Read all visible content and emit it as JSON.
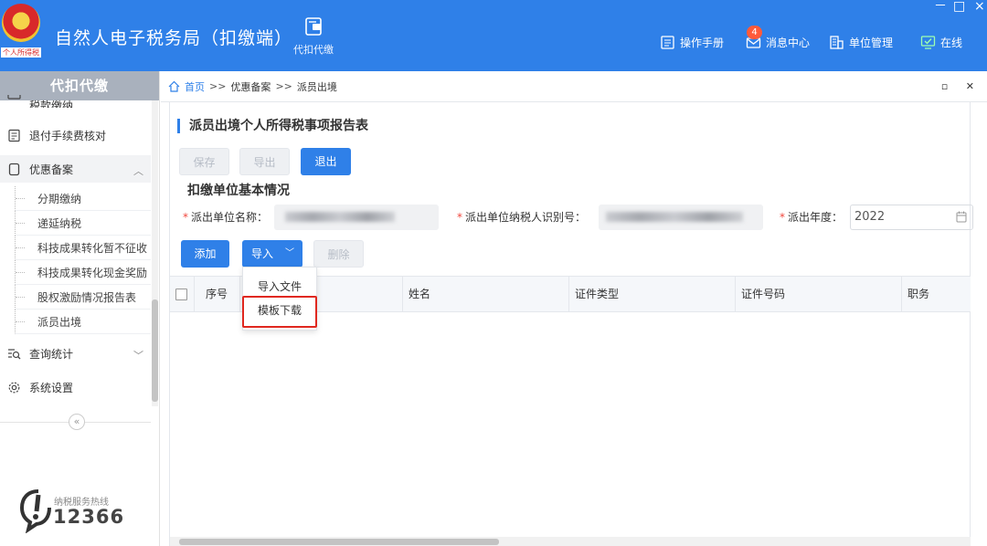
{
  "header": {
    "emblem_text": "个人所得税",
    "app_title": "自然人电子税务局（扣缴端）",
    "nav_label": "代扣代缴",
    "tools": [
      {
        "icon": "manual-icon",
        "label": "操作手册"
      },
      {
        "icon": "message-icon",
        "label": "消息中心",
        "badge": "4"
      },
      {
        "icon": "unit-icon",
        "label": "单位管理"
      },
      {
        "icon": "monitor-online-icon",
        "label": "在线"
      }
    ],
    "window_controls": [
      "－",
      "□",
      "×"
    ]
  },
  "sidebar": {
    "title": "代扣代缴",
    "partial_item": "税款缴纳",
    "items": [
      {
        "icon": "doc-icon",
        "label": "退付手续费核对"
      },
      {
        "icon": "file-icon",
        "label": "优惠备案",
        "expanded": true
      },
      {
        "icon": "search-stats-icon",
        "label": "查询统计"
      },
      {
        "icon": "gear-icon",
        "label": "系统设置"
      }
    ],
    "subitems": [
      "分期缴纳",
      "递延纳税",
      "科技成果转化暂不征收",
      "科技成果转化现金奖励",
      "股权激励情况报告表",
      "派员出境"
    ],
    "collapse_symbol": "«",
    "hotline_label": "纳税服务热线",
    "hotline_number": "12366"
  },
  "breadcrumb": {
    "home": "首页",
    "sep": ">>",
    "level1": "优惠备案",
    "level2": "派员出境",
    "controls": "▫ ✕"
  },
  "form": {
    "title": "派员出境个人所得税事项报告表",
    "buttons": {
      "save": "保存",
      "export": "导出",
      "exit": "退出"
    },
    "section_title": "扣缴单位基本情况",
    "fields": {
      "unit_name_label": "派出单位名称：",
      "tax_id_label": "派出单位纳税人识别号：",
      "year_label": "派出年度：",
      "year_value": "2022",
      "required_mark": "*"
    },
    "table_buttons": {
      "add": "添加",
      "import": "导入",
      "delete": "删除"
    },
    "import_menu": [
      "导入文件",
      "模板下载"
    ],
    "table_headers": [
      "序号",
      "姓名",
      "证件类型",
      "证件号码",
      "职务"
    ]
  },
  "colors": {
    "primary": "#2f80e8",
    "highlight": "#e0281f",
    "required": "#f0463c"
  }
}
